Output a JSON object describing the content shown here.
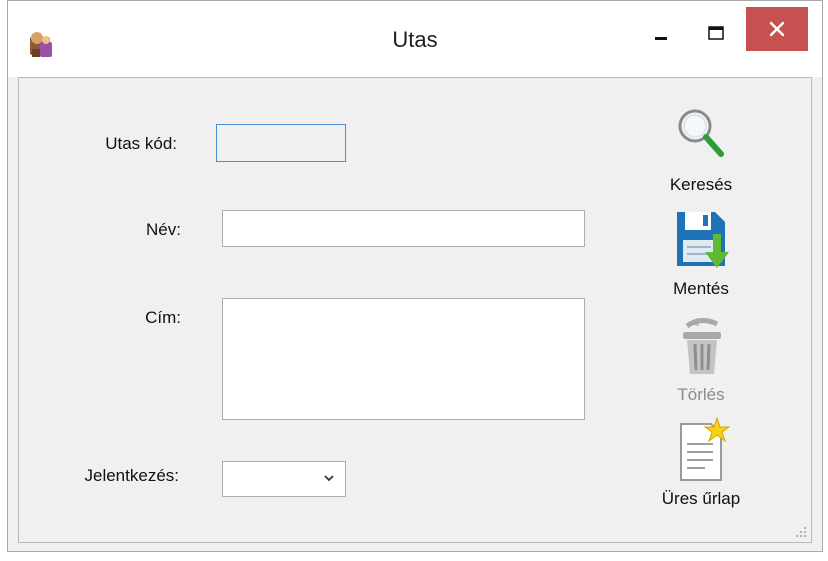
{
  "window": {
    "title": "Utas"
  },
  "form": {
    "utas_kod_label": "Utas kód:",
    "utas_kod_value": "",
    "nev_label": "Név:",
    "nev_value": "",
    "cim_label": "Cím:",
    "cim_value": "",
    "jelentkezes_label": "Jelentkezés:",
    "jelentkezes_value": ""
  },
  "actions": {
    "search_label": "Keresés",
    "save_label": "Mentés",
    "delete_label": "Törlés",
    "new_label": "Üres űrlap"
  },
  "colors": {
    "close_button": "#c75050",
    "focus_border": "#4b8fd6",
    "disabled_text": "#8c8c8c",
    "save_icon_blue": "#1e72b8",
    "save_icon_arrow": "#5fba2f"
  },
  "icons": {
    "app": "app-icon",
    "search": "magnifier-icon",
    "save": "floppy-disk-icon",
    "delete": "trash-can-icon",
    "new": "new-document-icon"
  }
}
